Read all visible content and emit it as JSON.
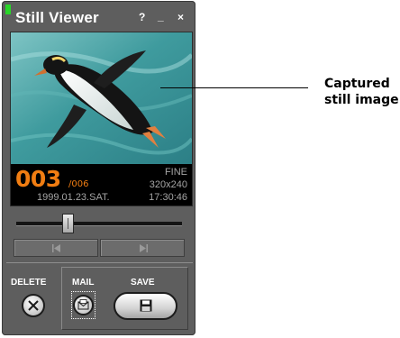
{
  "window": {
    "title": "Still Viewer",
    "help_label": "?",
    "minimize_label": "_",
    "close_label": "×",
    "status_led_color": "#29d629"
  },
  "viewer": {
    "image_subject": "penguin swimming underwater",
    "frame_current": "003",
    "frame_total": "/006",
    "quality": "FINE",
    "resolution": "320x240",
    "date": "1999.01.23.SAT.",
    "time": "17:30:46",
    "accent_color": "#f07d12"
  },
  "slider": {
    "position_fraction": 0.3
  },
  "navigation": {
    "prev_icon": "skip-previous-icon",
    "next_icon": "skip-next-icon"
  },
  "actions": {
    "delete_label": "DELETE",
    "mail_label": "MAIL",
    "save_label": "SAVE",
    "delete_icon": "close-circle-icon",
    "mail_icon": "mail-icon",
    "save_icon": "floppy-disk-icon"
  },
  "callout": {
    "line1": "Captured",
    "line2": "still image"
  }
}
